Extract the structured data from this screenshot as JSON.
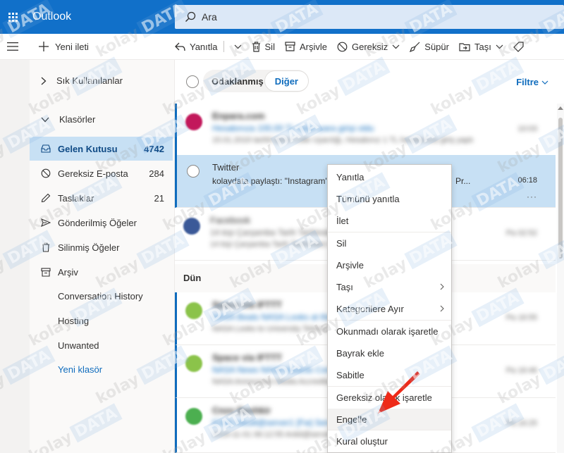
{
  "app": {
    "title": "Outlook",
    "brand_color": "#1170c9",
    "accent_color": "#0f6cbd"
  },
  "search": {
    "placeholder": "Ara"
  },
  "toolbar": {
    "new_message": "Yeni ileti",
    "reply": "Yanıtla",
    "delete": "Sil",
    "archive": "Arşivle",
    "junk": "Gereksiz",
    "sweep": "Süpür",
    "move": "Taşı"
  },
  "sidebar": {
    "favorites_label": "Sık Kullanılanlar",
    "folders_label": "Klasörler",
    "items": [
      {
        "label": "Gelen Kutusu",
        "count": "4742",
        "icon": "inbox-icon"
      },
      {
        "label": "Gereksiz E-posta",
        "count": "284",
        "icon": "block-icon"
      },
      {
        "label": "Taslaklar",
        "count": "21",
        "icon": "pencil-icon"
      },
      {
        "label": "Gönderilmiş Öğeler",
        "count": "",
        "icon": "send-icon"
      },
      {
        "label": "Silinmiş Öğeler",
        "count": "",
        "icon": "trash-icon"
      },
      {
        "label": "Arşiv",
        "count": "",
        "icon": "archive-icon"
      },
      {
        "label": "Conversation History",
        "count": ""
      },
      {
        "label": "Hosting",
        "count": ""
      },
      {
        "label": "Unwanted",
        "count": ""
      }
    ],
    "new_folder": "Yeni klasör"
  },
  "list": {
    "tab_focused": "Odaklanmış",
    "tab_other": "Diğer",
    "filter": "Filtre",
    "date_header": "Dün",
    "messages": [
      {
        "from": "Enpara.com",
        "subject": "Hesabınıza 100,00 TL tutarı para girişi oldu",
        "preview": "15.01.2019 tarihli işlem Cafe Uyarılığı, Hesabınız 1 TL hesabınıza giriş yaptı",
        "time": "10:03",
        "avatar_color": "#c2185b"
      },
      {
        "from": "Twitter",
        "subject": "kolaydata paylaştı: \"Instagram'da",
        "subject_tail": "Pr...",
        "preview": "",
        "time": "06:18"
      },
      {
        "from": "Facebook",
        "subject": "14 kişi Çarşamba Tarih Tarihinden önce",
        "preview": "14 kişi Çarşamba Tarih Tarihinden bu arkadaş bağlantı Mehme",
        "time": "Pa 02:52",
        "avatar_color": "#3b5998"
      },
      {
        "from": "Space via IFTTT",
        "subject": "NASA Beats NASA Looks at the Limits",
        "preview": "NASA Looks to University Telescope to Gather Tarih Solutions",
        "time": "Pa 16:55",
        "avatar_color": "#8bc34a"
      },
      {
        "from": "Space via IFTTT",
        "subject": "NASA News NASA Awards Contract",
        "preview": "NASA Announces Media Accreditation for Tarih Mission",
        "time": "Pa 16:46",
        "avatar_color": "#8bc34a"
      },
      {
        "from": "Cnzo Bashkir",
        "subject": "[Cbd] Inbuilt@server1 [Fw] Server",
        "preview": "2019-11-01 06:12:55 Ankit@server.com",
        "time": "Pa 16:25",
        "avatar_color": "#4caf50"
      }
    ]
  },
  "context_menu": {
    "items": [
      {
        "label": "Yanıtla"
      },
      {
        "label": "Tümünü yanıtla"
      },
      {
        "label": "İlet"
      },
      {
        "label": "Sil"
      },
      {
        "label": "Arşivle"
      },
      {
        "label": "Taşı",
        "submenu": true
      },
      {
        "label": "Kategorilere Ayır",
        "submenu": true
      },
      {
        "label": "Okunmadı olarak işaretle"
      },
      {
        "label": "Bayrak ekle"
      },
      {
        "label": "Sabitle"
      },
      {
        "label": "Gereksiz olarak işaretle"
      },
      {
        "label": "Engelle",
        "highlighted": true
      },
      {
        "label": "Kural oluştur"
      }
    ]
  },
  "watermark": {
    "text_a": "kolay",
    "text_b": "DATA"
  }
}
